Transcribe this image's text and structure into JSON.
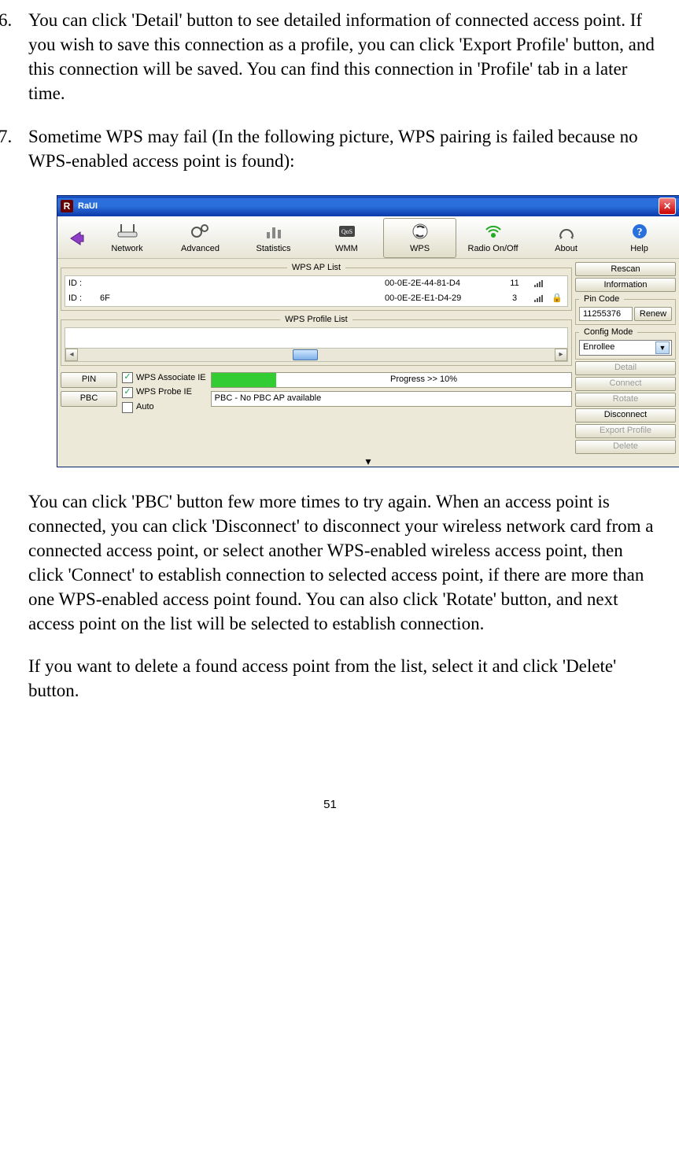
{
  "list": {
    "item6": {
      "num": "6.",
      "text": "You can click 'Detail' button to see detailed information of connected access point. If you wish to save this connection as a profile, you can click 'Export Profile' button, and this connection will be saved. You can find this connection in 'Profile' tab in a later time."
    },
    "item7": {
      "num": "7.",
      "text": "Sometime WPS may fail (In the following picture, WPS pairing is failed because no WPS-enabled access point is found):"
    }
  },
  "paragraphs": {
    "p1": "You can click 'PBC' button few more times to try again. When an access point is connected, you can click 'Disconnect' to disconnect your wireless network card from a connected access point, or select another WPS-enabled wireless access point, then click 'Connect' to establish connection to selected access point, if there are more than one WPS-enabled access point found. You can also click 'Rotate' button, and next access point on the list will be selected to establish connection.",
    "p2": "If you want to delete a found access point from the list, select it and click 'Delete' button."
  },
  "page_number": "51",
  "screenshot": {
    "app_title": "RaUI",
    "toolbar": {
      "network": "Network",
      "advanced": "Advanced",
      "statistics": "Statistics",
      "wmm": "WMM",
      "wps": "WPS",
      "radio": "Radio On/Off",
      "about": "About",
      "help": "Help"
    },
    "ap_list": {
      "legend": "WPS AP List",
      "rows": [
        {
          "id": "ID :",
          "name": "",
          "mac": "00-0E-2E-44-81-D4",
          "ch": "11"
        },
        {
          "id": "ID :",
          "name": "6F",
          "mac": "00-0E-2E-E1-D4-29",
          "ch": "3"
        }
      ]
    },
    "profile_list": {
      "legend": "WPS Profile List"
    },
    "buttons": {
      "pin": "PIN",
      "pbc": "PBC"
    },
    "checks": {
      "assoc": "WPS Associate IE",
      "probe": "WPS Probe IE",
      "auto": "Auto"
    },
    "progress": {
      "text": "Progress >> 10%",
      "percent": 10
    },
    "status": "PBC - No PBC AP available",
    "side": {
      "rescan": "Rescan",
      "information": "Information",
      "pincode_legend": "Pin Code",
      "pincode_value": "11255376",
      "renew": "Renew",
      "config_legend": "Config Mode",
      "config_value": "Enrollee",
      "detail": "Detail",
      "connect": "Connect",
      "rotate": "Rotate",
      "disconnect": "Disconnect",
      "export": "Export Profile",
      "delete": "Delete"
    }
  }
}
